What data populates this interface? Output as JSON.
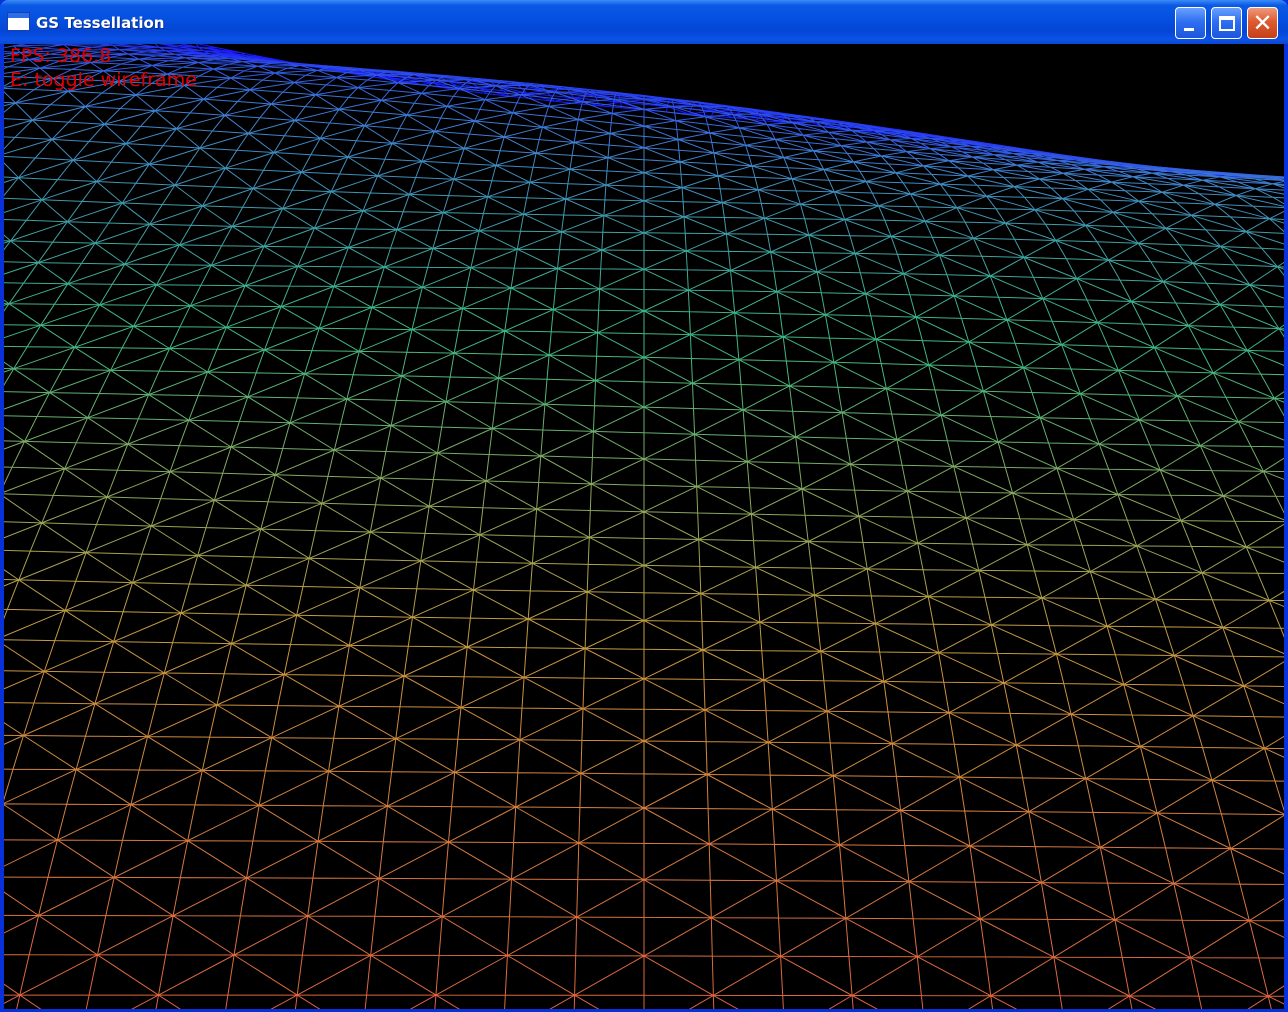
{
  "window": {
    "title": "GS Tessellation",
    "icon": "app-window-icon",
    "controls": {
      "minimize": "minimize-icon",
      "maximize": "maximize-icon",
      "close": "close-icon",
      "close_glyph": "✕"
    }
  },
  "overlay": {
    "fps_text": "FPS: 386.8",
    "hint_text": "E: toggle wireframe",
    "text_color": "#e00000"
  },
  "scene": {
    "render_mode": "wireframe",
    "background": "#000000",
    "gradient_colors": [
      "#1a1aff",
      "#3f7fd0",
      "#3fb880",
      "#c89a40",
      "#e06040"
    ]
  }
}
